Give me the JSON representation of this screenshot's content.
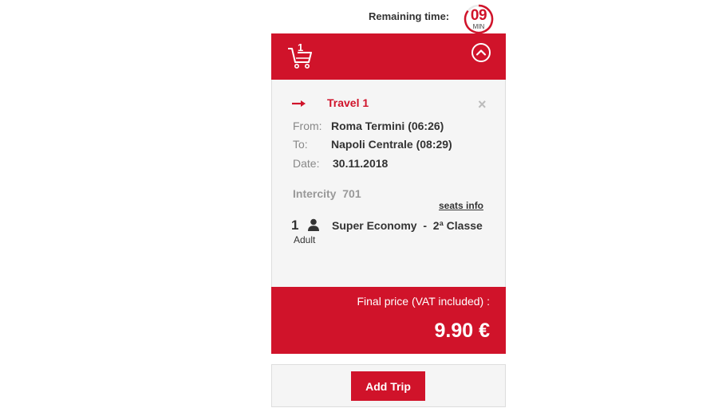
{
  "timer": {
    "label": "Remaining time:",
    "minutes": "09",
    "unit": "MIN"
  },
  "cart": {
    "count": "1",
    "icons": {
      "cart": "shopping-cart-icon",
      "collapse": "chevron-up-circle-icon"
    }
  },
  "trip": {
    "title": "Travel 1",
    "remove_label": "×",
    "from_label": "From:",
    "from_value": "Roma Termini (06:26)",
    "to_label": "To:",
    "to_value": "Napoli Centrale (08:29)",
    "date_label": "Date:",
    "date_value": "30.11.2018",
    "train": "Intercity  701",
    "seats_link": "seats info",
    "passengers": {
      "count": "1",
      "type": "Adult",
      "fare": "Super Economy  -  2ª Classe"
    }
  },
  "price": {
    "label": "Final price (VAT included) :",
    "value": "9.90 €"
  },
  "actions": {
    "add_trip": "Add Trip"
  },
  "colors": {
    "brand_red": "#d0132a",
    "panel_bg": "#f5f5f5"
  }
}
